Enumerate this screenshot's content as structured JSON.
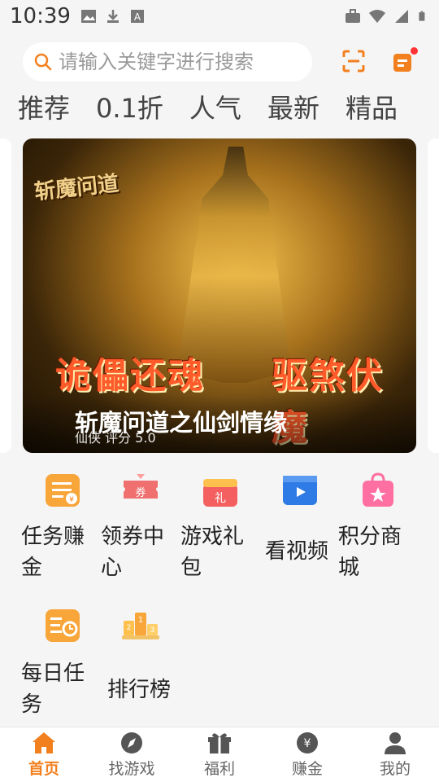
{
  "status_bar": {
    "time": "10:39",
    "left_icons": [
      "image-icon",
      "download-icon",
      "a-icon"
    ],
    "right_icons": [
      "briefcase-icon",
      "wifi-icon",
      "signal-icon",
      "battery-icon"
    ]
  },
  "search": {
    "placeholder": "请输入关键字进行搜索",
    "scan_icon": "scan-icon",
    "message_icon": "message-icon"
  },
  "tabs": [
    "推荐",
    "0.1折",
    "人气",
    "最新",
    "精品"
  ],
  "banner": {
    "logo_text": "斩魔问道",
    "slogan_left": "诡儡还魂",
    "slogan_right": "驱煞伏魔",
    "title": "斩魔问道之仙剑情缘",
    "subtitle": "仙侠   评分 5.0"
  },
  "features": [
    {
      "line1": "任务赚",
      "line2": "金",
      "icon": "task-coin-icon"
    },
    {
      "line1": "领券中",
      "line2": "心",
      "icon": "coupon-icon"
    },
    {
      "line1": "游戏礼",
      "line2": "包",
      "icon": "gift-pack-icon"
    },
    {
      "line1": "看视频",
      "line2": "",
      "icon": "video-icon"
    },
    {
      "line1": "积分商",
      "line2": "城",
      "icon": "points-shop-icon"
    },
    {
      "line1": "每日任",
      "line2": "务",
      "icon": "daily-task-icon"
    },
    {
      "line1": "排行榜",
      "line2": "",
      "icon": "ranking-icon"
    }
  ],
  "bottom_nav": [
    {
      "label": "首页",
      "icon": "home-icon",
      "active": true
    },
    {
      "label": "找游戏",
      "icon": "compass-icon",
      "active": false
    },
    {
      "label": "福利",
      "icon": "gift-icon",
      "active": false
    },
    {
      "label": "赚金",
      "icon": "coin-icon",
      "active": false
    },
    {
      "label": "我的",
      "icon": "user-icon",
      "active": false
    }
  ],
  "colors": {
    "accent": "#f2801f",
    "background": "#f5f5f5",
    "badge": "#ff3333"
  }
}
